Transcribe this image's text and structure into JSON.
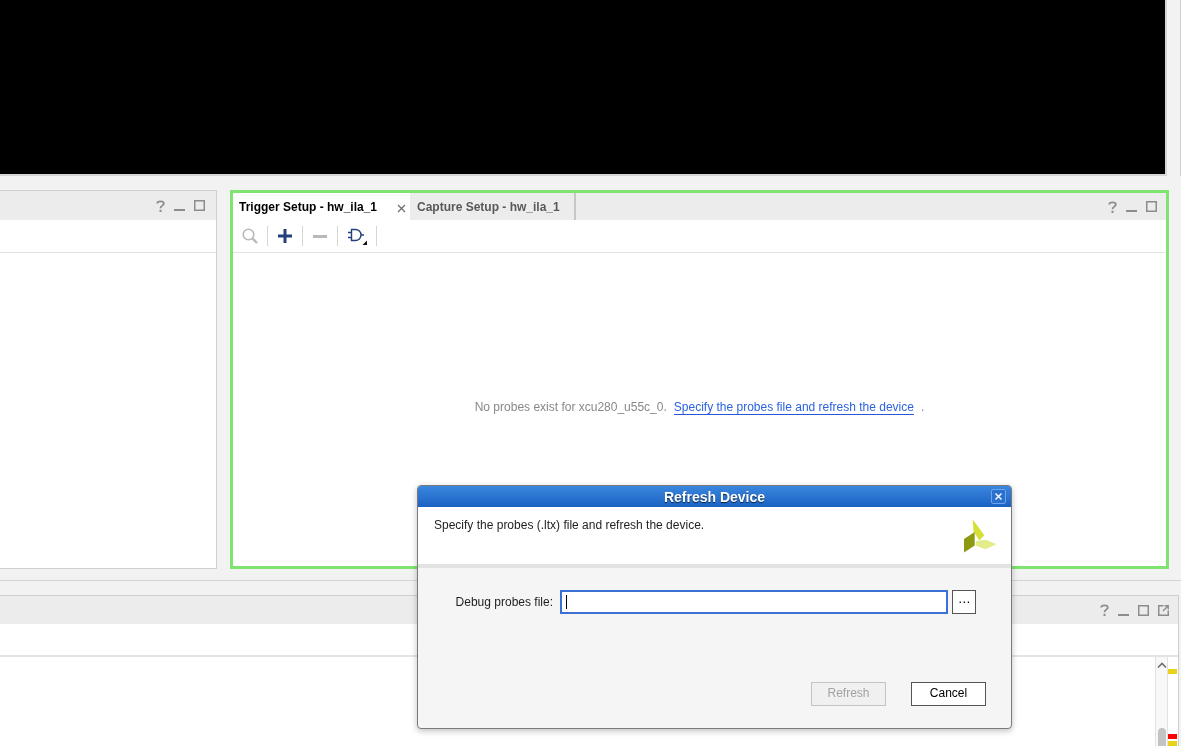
{
  "trigger_panel": {
    "highlighted": true,
    "tabs": [
      {
        "label": "Trigger Setup - hw_ila_1",
        "selected": true
      },
      {
        "label": "Capture Setup - hw_ila_1",
        "selected": false
      }
    ],
    "toolbar": [
      {
        "kind": "search",
        "disabled": true
      },
      {
        "kind": "add",
        "disabled": false
      },
      {
        "kind": "remove",
        "disabled": true
      },
      {
        "kind": "gate",
        "disabled": false
      }
    ],
    "message": {
      "text": "No probes exist for xcu280_u55c_0.",
      "link": "Specify the probes file and refresh the device",
      "end": "."
    }
  },
  "bottom_panel": {
    "overview_marks": [
      {
        "color": "#e8d21c"
      },
      {
        "color": "#ff0000"
      },
      {
        "color": "#e8d21c"
      }
    ]
  },
  "dialog": {
    "title": "Refresh Device",
    "description": "Specify the probes (.ltx) file and refresh the device.",
    "field": {
      "label": "Debug probes file:",
      "focused": true
    },
    "browse_button": "⋯",
    "buttons": [
      {
        "label": "Refresh",
        "disabled": true
      },
      {
        "label": "Cancel",
        "disabled": false
      }
    ]
  }
}
